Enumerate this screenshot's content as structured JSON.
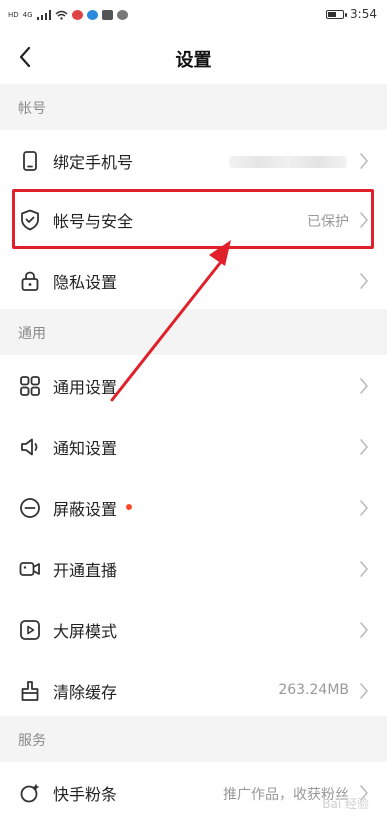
{
  "status_bar": {
    "left_tags": [
      "HD",
      "4G"
    ],
    "time": "3:54",
    "battery_level": 0.6
  },
  "header": {
    "title": "设置",
    "back_icon": "chevron-left-icon"
  },
  "sections": {
    "account": "帐号",
    "general": "通用",
    "services": "服务"
  },
  "rows": {
    "bind_phone": {
      "label": "绑定手机号",
      "value": "",
      "icon": "phone-icon"
    },
    "account_security": {
      "label": "帐号与安全",
      "value": "已保护",
      "icon": "shield-check-icon"
    },
    "privacy": {
      "label": "隐私设置",
      "icon": "lock-icon"
    },
    "general_settings": {
      "label": "通用设置",
      "icon": "grid-icon"
    },
    "notification": {
      "label": "通知设置",
      "icon": "speaker-icon"
    },
    "block": {
      "label": "屏蔽设置",
      "icon": "minus-circle-icon"
    },
    "live": {
      "label": "开通直播",
      "icon": "video-camera-icon"
    },
    "big_screen": {
      "label": "大屏模式",
      "icon": "play-screen-icon"
    },
    "clear_cache": {
      "label": "清除缓存",
      "value": "263.24MB",
      "icon": "broom-icon"
    },
    "fans": {
      "label": "快手粉条",
      "value": "推广作品，收获粉丝",
      "icon": "sparkle-icon"
    }
  },
  "colors": {
    "accent_red": "#e0202b",
    "badge_dot": "#ff4b2b",
    "section_bg": "#f4f4f4"
  },
  "watermark": "Bai 经验"
}
